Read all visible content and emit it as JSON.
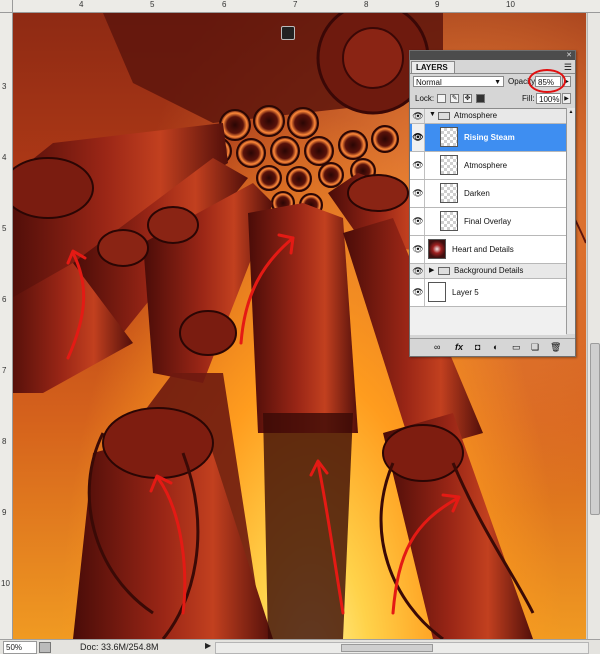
{
  "ruler": {
    "top_ticks": [
      "4",
      "5",
      "6",
      "7",
      "8",
      "9",
      "10"
    ],
    "left_ticks": [
      "3",
      "4",
      "5",
      "6",
      "7",
      "8",
      "9",
      "10"
    ]
  },
  "canvas": {
    "toolbar_icon": "photoshop-mini-icon",
    "annotation_color": "#e41a14"
  },
  "layers_panel": {
    "title": "LAYERS",
    "menu_icon": "panel-menu-icon",
    "blend_mode": "Normal",
    "opacity_label": "Opacity:",
    "opacity_value": "85%",
    "lock_label": "Lock:",
    "fill_label": "Fill:",
    "fill_value": "100%",
    "selected_color": "#3e8ef1",
    "highlight_color": "#e01010",
    "layers": [
      {
        "name": "Atmosphere",
        "type": "group",
        "expanded": true
      },
      {
        "name": "Rising Steam",
        "type": "layer",
        "selected": true
      },
      {
        "name": "Atmosphere",
        "type": "layer"
      },
      {
        "name": "Darken",
        "type": "layer"
      },
      {
        "name": "Final Overlay",
        "type": "layer"
      },
      {
        "name": "Heart and Details",
        "type": "layer"
      },
      {
        "name": "Background Details",
        "type": "group",
        "expanded": false
      },
      {
        "name": "Layer 5",
        "type": "layer"
      }
    ],
    "footer_icons": [
      "link-icon",
      "fx-icon",
      "mask-icon",
      "adjustment-icon",
      "folder-icon",
      "new-layer-icon",
      "trash-icon"
    ]
  },
  "status": {
    "zoom": "50%",
    "doc": "Doc: 33.6M/254.8M"
  }
}
